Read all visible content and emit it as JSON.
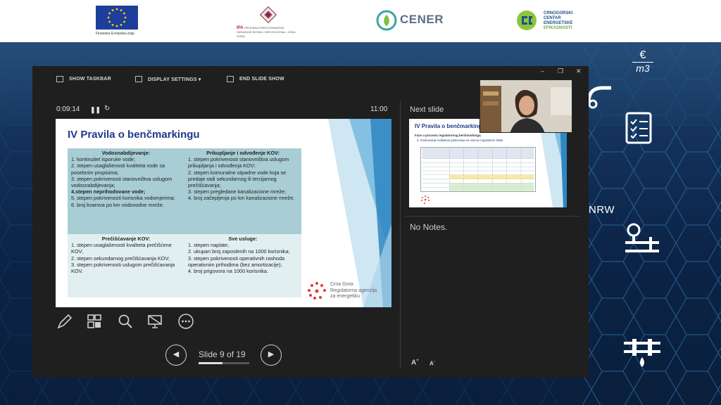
{
  "logos": {
    "eu_caption": "Finansira Evropska unija",
    "ipa_caption": "IPA",
    "ipa_program": "PROGRAM PREKOGRANIČNE SARADNJE BOSNA I HERCEGOVINA - CRNA GORA",
    "cener_name": "CENER",
    "ccee_line1": "CRNOGORSKI",
    "ccee_line2": "CENTAR",
    "ccee_line3": "ENERGETSKE",
    "ccee_line4": "EFIKASNOSTI"
  },
  "background": {
    "euro_icon_top": "€",
    "euro_icon_bottom": "m3",
    "nrw_label": "NRW"
  },
  "toolbar": {
    "show_taskbar": "SHOW TASKBAR",
    "display_settings": "DISPLAY SETTINGS ▾",
    "end_slide_show": "END SLIDE SHOW"
  },
  "timer": {
    "elapsed": "0:09:14",
    "clock": "11:00"
  },
  "slide": {
    "title": "IV Pravila o benčmarkingu",
    "cells": [
      {
        "heading": "Vodosnabdijevanje:",
        "items": [
          "1. kontinuitet isporuke vode;",
          "2. stepen usaglašenosti kvaliteta vode sa posebnim propisima;",
          "3. stepen pokrivenosti stanovništva uslugom vodosnabdijevanja;",
          "4.stepen neprihodovane vode;",
          "5. stepen pokrivenosti korisnika vodomjerima;",
          "6. broj kvarova po km vodovodne mreže."
        ]
      },
      {
        "heading": "Prikupljanje i odvođenje KOV:",
        "items": [
          "1. stepen pokrivenosti stanovništva uslugom prikupljanja i odvođenja KOV;",
          "2. stepen komunalne otpadne vode koja se predaje radi sekundarnog ili tercijarnog prečišćavanja;",
          "3. stepen pregledane kanalizacione mreže;",
          "4. broj začepljenja po km kanalizacione mreže."
        ]
      },
      {
        "heading": "Prečišćavanje KOV:",
        "items": [
          "1. stepen usaglašenosti kvaliteta prečišćene KOV;",
          "2. stepen sekundarnog prečišćavanja KOV;",
          "3. stepen pokrivenosti uslugom prečišćavanja KOV."
        ]
      },
      {
        "heading": "Sve usluge:",
        "items": [
          "1. stepen naplate;",
          "2. ukupan broj zaposlenih na 1000 korisnika;",
          "3. stepen pokrivenosti operativnih rashoda operativnim prihodima (bez amortizacije);",
          "4. broj prigovora na 1000 korisnika."
        ]
      }
    ],
    "agency_line1": "Crna Gora",
    "agency_line2": "Regulatorna agencija",
    "agency_line3": "za energetiku"
  },
  "tools": {
    "pen": "pen-icon",
    "grid": "slides-grid-icon",
    "zoom": "zoom-icon",
    "black_screen": "black-screen-icon",
    "more": "more-options-icon"
  },
  "navigation": {
    "prev": "◀",
    "next": "▶",
    "counter": "Slide 9 of 19",
    "current": 9,
    "total": 19
  },
  "next_slide": {
    "label": "Next slide",
    "title": "IV Pravila o benčmarkingu",
    "subtitle1": "Faze u procesu regulatornog benčmarkinga.",
    "subtitle2": "3. Vrednovanje indikatora poslovanja na osnovu regulatorne skale."
  },
  "notes": {
    "text": "No Notes."
  },
  "font_controls": {
    "increase": "A",
    "decrease": "A"
  }
}
